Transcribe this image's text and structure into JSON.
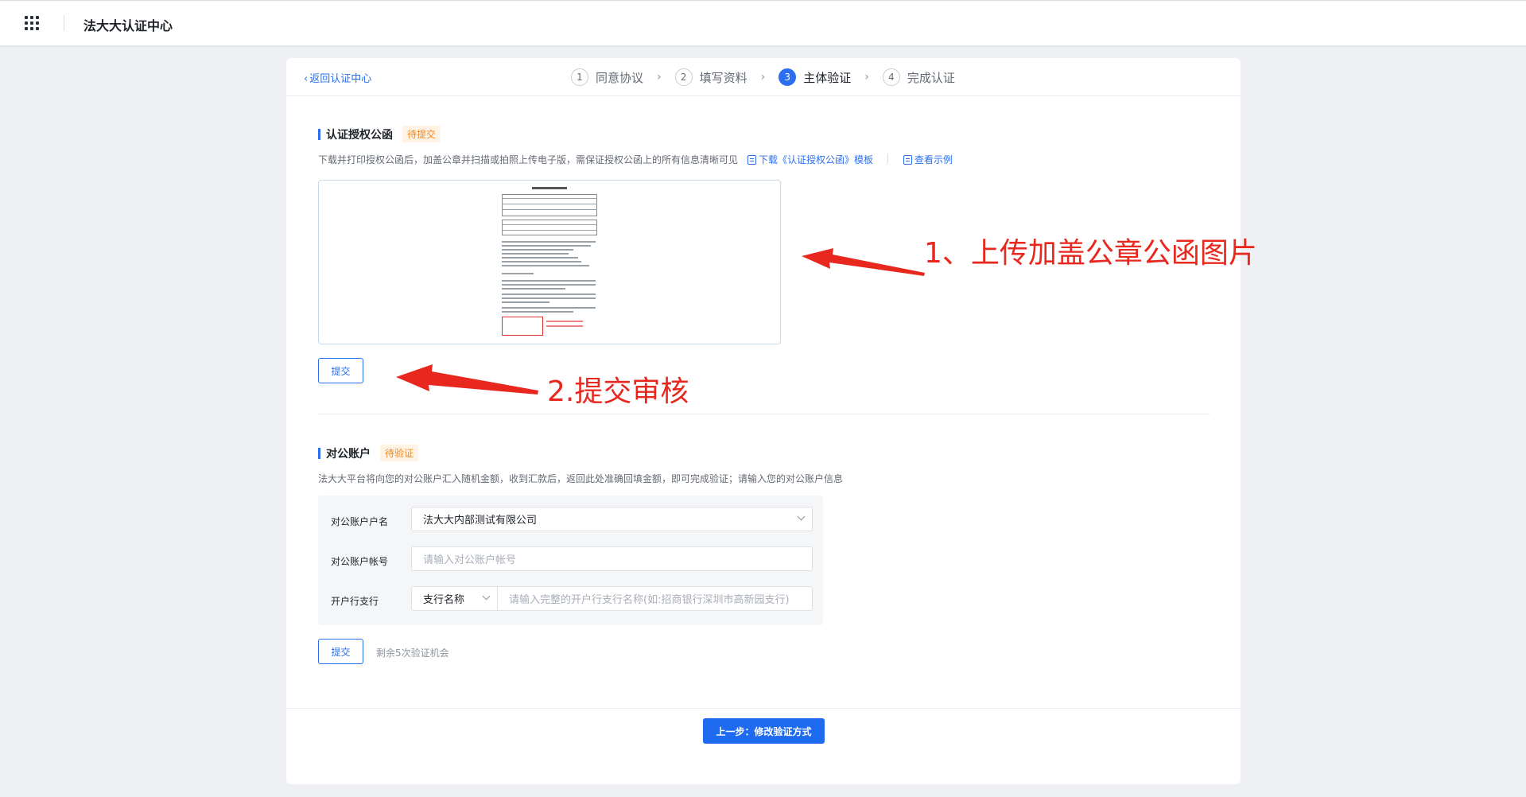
{
  "header": {
    "app_title": "法大大认证中心",
    "apps_icon": "apps-grid-icon"
  },
  "nav": {
    "back_label": "返回认证中心",
    "steps": [
      {
        "num": "1",
        "label": "同意协议",
        "active": false
      },
      {
        "num": "2",
        "label": "填写资料",
        "active": false
      },
      {
        "num": "3",
        "label": "主体验证",
        "active": true
      },
      {
        "num": "4",
        "label": "完成认证",
        "active": false
      }
    ]
  },
  "letter_section": {
    "title": "认证授权公函",
    "status": "待提交",
    "description": "下载并打印授权公函后，加盖公章并扫描或拍照上传电子版，需保证授权公函上的所有信息清晰可见",
    "download_link": "下载《认证授权公函》模板",
    "example_link": "查看示例",
    "submit_label": "提交"
  },
  "account_section": {
    "title": "对公账户",
    "status": "待验证",
    "description": "法大大平台将向您的对公账户汇入随机金额，收到汇款后，返回此处准确回填金额，即可完成验证；请输入您的对公账户信息",
    "fields": {
      "name_label": "对公账户户名",
      "name_value": "法大大内部测试有限公司",
      "number_label": "对公账户帐号",
      "number_placeholder": "请输入对公账户帐号",
      "branch_label": "开户行支行",
      "branch_select": "支行名称",
      "branch_placeholder": "请输入完整的开户行支行名称(如:招商银行深圳市高新园支行)"
    },
    "submit_label": "提交",
    "remaining_text": "剩余5次验证机会"
  },
  "footer": {
    "prev_button": "上一步：修改验证方式"
  },
  "annotations": {
    "upload_note": "1、上传加盖公章公函图片",
    "submit_note": "2.提交审核"
  },
  "colors": {
    "accent": "#2b6ff0",
    "pending": "#f08a24",
    "annotation": "#e8281e"
  }
}
